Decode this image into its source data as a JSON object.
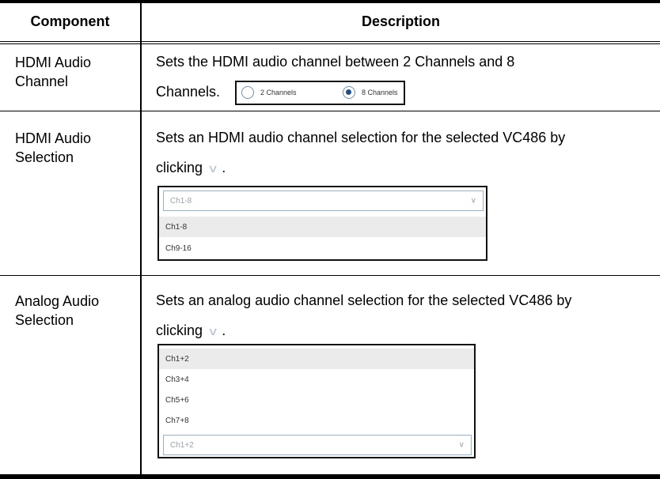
{
  "headers": {
    "component": "Component",
    "description": "Description"
  },
  "rows": [
    {
      "component": "HDMI Audio Channel",
      "description_line1": "Sets the HDMI audio channel between 2 Channels and 8",
      "description_line2": "Channels.",
      "radio": {
        "option1": "2 Channels",
        "option2": "8 Channels",
        "selected": "8 Channels"
      }
    },
    {
      "component": "HDMI Audio Selection",
      "description_line1": "Sets an HDMI audio channel selection for the selected VC486 by",
      "description_line2": "clicking",
      "description_end": ".",
      "chevron_icon": "chevron-down-icon",
      "dropdown": {
        "selected": "Ch1-8",
        "options": [
          "Ch1-8",
          "Ch9-16"
        ],
        "highlighted": "Ch1-8"
      }
    },
    {
      "component": "Analog Audio Selection",
      "description_line1": "Sets an analog audio channel selection for the selected VC486 by",
      "description_line2": "clicking",
      "description_end": ".",
      "chevron_icon": "chevron-down-icon",
      "dropdown": {
        "selected": "Ch1+2",
        "options": [
          "Ch1+2",
          "Ch3+4",
          "Ch5+6",
          "Ch7+8"
        ],
        "highlighted": "Ch1+2"
      }
    }
  ]
}
